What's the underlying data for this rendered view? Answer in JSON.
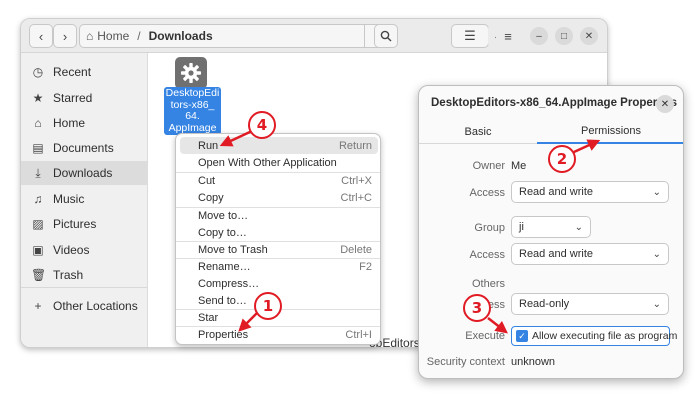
{
  "files_window": {
    "path": {
      "home": "Home",
      "separator": "/",
      "current": "Downloads"
    },
    "sidebar": [
      {
        "icon": "clock-icon",
        "glyph": "◷",
        "label": "Recent"
      },
      {
        "icon": "star-icon",
        "glyph": "★",
        "label": "Starred"
      },
      {
        "icon": "home-icon",
        "glyph": "⌂",
        "label": "Home"
      },
      {
        "icon": "document-icon",
        "glyph": "▤",
        "label": "Documents"
      },
      {
        "icon": "download-icon",
        "glyph": "⤓",
        "label": "Downloads",
        "active": true
      },
      {
        "icon": "music-icon",
        "glyph": "♫",
        "label": "Music"
      },
      {
        "icon": "picture-icon",
        "glyph": "▨",
        "label": "Pictures"
      },
      {
        "icon": "video-icon",
        "glyph": "▣",
        "label": "Videos"
      },
      {
        "icon": "trash-icon",
        "glyph": "🗑",
        "label": "Trash"
      },
      {
        "icon": "plus-icon",
        "glyph": "+",
        "label": "Other Locations"
      }
    ],
    "file": {
      "icon": "gear-icon",
      "name": "DesktopEditors-x86_64.AppImage",
      "label_lines": [
        "DesktopEdi",
        "tors-x86_",
        "64.",
        "AppImage"
      ]
    },
    "status_fragment": "opEditors"
  },
  "context_menu": [
    {
      "label": "Run",
      "accel": "Return",
      "hover": true
    },
    {
      "label": "Open With Other Application",
      "accel": ""
    },
    {
      "label": "Cut",
      "accel": "Ctrl+X"
    },
    {
      "label": "Copy",
      "accel": "Ctrl+C"
    },
    {
      "label": "Move to…",
      "accel": ""
    },
    {
      "label": "Copy to…",
      "accel": ""
    },
    {
      "label": "Move to Trash",
      "accel": "Delete"
    },
    {
      "label": "Rename…",
      "accel": "F2"
    },
    {
      "label": "Compress…",
      "accel": ""
    },
    {
      "label": "Send to…",
      "accel": ""
    },
    {
      "label": "Star",
      "accel": ""
    },
    {
      "label": "Properties",
      "accel": "Ctrl+I"
    }
  ],
  "properties_dialog": {
    "title": "DesktopEditors-x86_64.AppImage Properties",
    "tabs": {
      "basic": "Basic",
      "permissions": "Permissions"
    },
    "owner_label": "Owner",
    "owner_value": "Me",
    "owner_access_label": "Access",
    "owner_access_value": "Read and write",
    "group_label": "Group",
    "group_value": "ji",
    "group_access_label": "Access",
    "group_access_value": "Read and write",
    "others_label": "Others",
    "others_access_label": "Access",
    "others_access_value": "Read-only",
    "execute_label": "Execute",
    "execute_value": "Allow executing file as program",
    "execute_checked": true,
    "security_label": "Security context",
    "security_value": "unknown"
  },
  "annotations": {
    "b1": "1",
    "b2": "2",
    "b3": "3",
    "b4": "4",
    "color": "#e01b24"
  },
  "colors": {
    "accent": "#3584e4",
    "annotation": "#e01b24"
  }
}
